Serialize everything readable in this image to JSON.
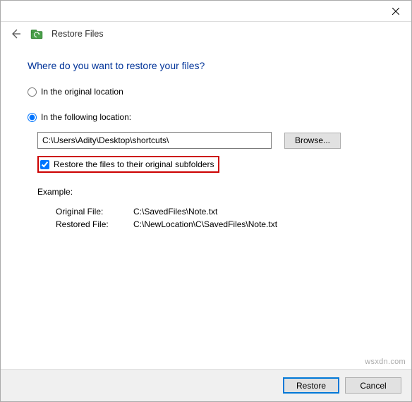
{
  "window": {
    "title": "Restore Files"
  },
  "heading": "Where do you want to restore your files?",
  "options": {
    "original": {
      "label": "In the original location",
      "selected": false
    },
    "following": {
      "label": "In the following location:",
      "selected": true,
      "path": "C:\\Users\\Adity\\Desktop\\shortcuts\\",
      "browse_label": "Browse...",
      "restore_subfolders": {
        "label": "Restore the files to their original subfolders",
        "checked": true
      }
    }
  },
  "example": {
    "heading": "Example:",
    "original_label": "Original File:",
    "original_value": "C:\\SavedFiles\\Note.txt",
    "restored_label": "Restored File:",
    "restored_value": "C:\\NewLocation\\C\\SavedFiles\\Note.txt"
  },
  "footer": {
    "restore": "Restore",
    "cancel": "Cancel"
  },
  "watermark": "wsxdn.com"
}
